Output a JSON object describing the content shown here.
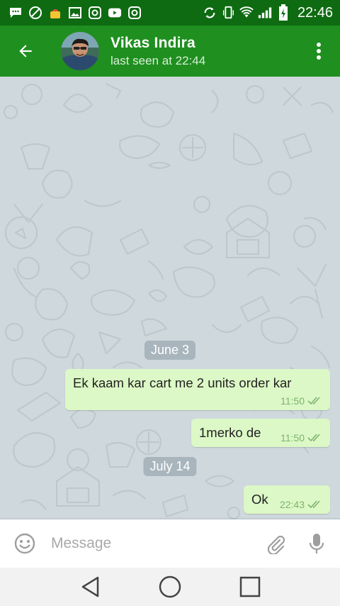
{
  "status_bar": {
    "time": "22:46",
    "icons": [
      "message-icon",
      "disc-icon",
      "notification-icon",
      "gallery-icon",
      "instagram-icon",
      "youtube-icon",
      "instagram-icon",
      "sync-icon",
      "vibrate-icon",
      "wifi-icon",
      "signal-icon",
      "battery-icon"
    ]
  },
  "header": {
    "contact_name": "Vikas Indira",
    "last_seen": "last seen at 22:44",
    "back_icon": "arrow-left-icon",
    "menu_icon": "more-vert-icon"
  },
  "messages": [
    {
      "type": "date",
      "text": "June 3"
    },
    {
      "type": "outgoing",
      "text": "Ek kaam kar cart me 2 units order kar",
      "time": "11:50",
      "status": "read"
    },
    {
      "type": "outgoing",
      "text": "1merko de",
      "time": "11:50",
      "status": "read"
    },
    {
      "type": "date",
      "text": "July 14"
    },
    {
      "type": "outgoing",
      "text": "Ok",
      "time": "22:43",
      "status": "read"
    }
  ],
  "composer": {
    "placeholder": "Message",
    "emoji_icon": "emoji-icon",
    "attach_icon": "paperclip-icon",
    "mic_icon": "microphone-icon"
  },
  "nav_bar": {
    "buttons": [
      "back-triangle-icon",
      "home-circle-icon",
      "recents-square-icon"
    ]
  },
  "colors": {
    "status_bar": "#0e6b12",
    "app_bar": "#1f8f1f",
    "chat_background": "#cfd8dc",
    "outgoing_bubble": "#dcf8c6",
    "read_ticks": "#7fb36f"
  }
}
